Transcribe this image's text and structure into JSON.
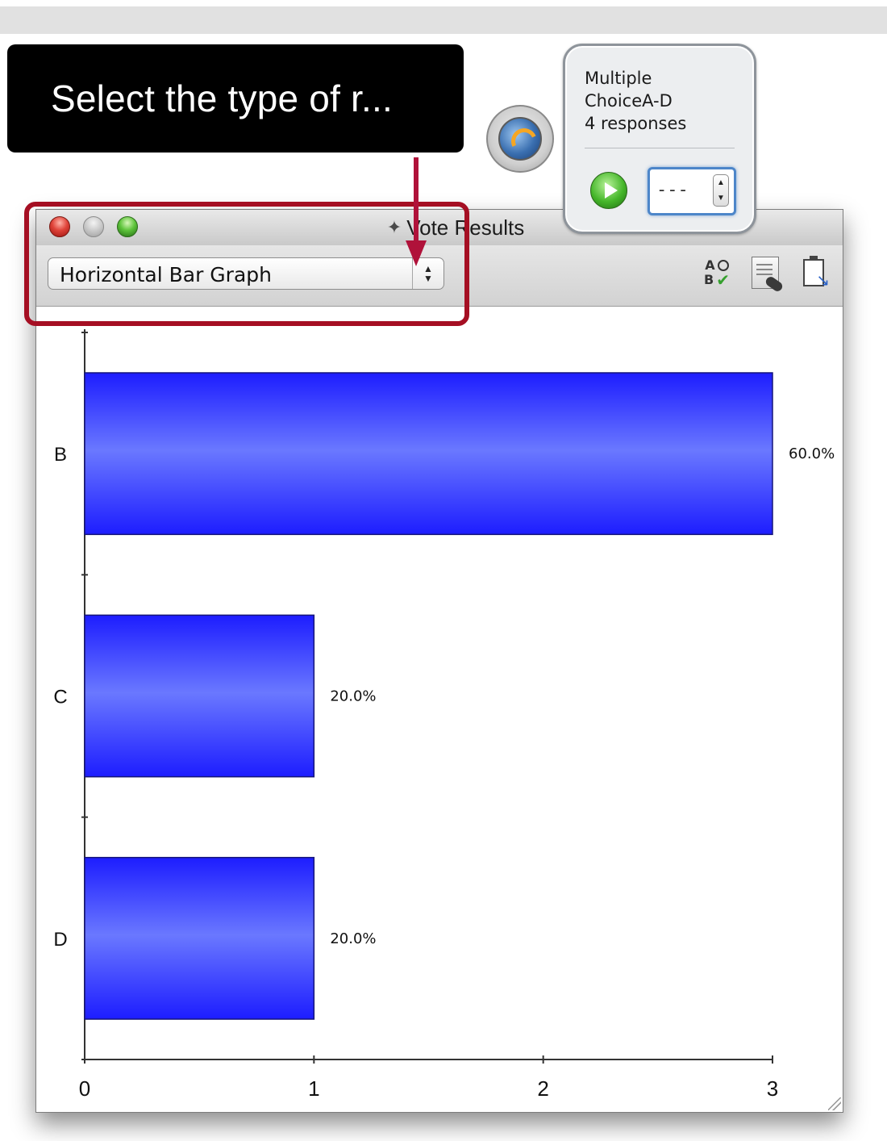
{
  "callout": {
    "text": "Select the type of r..."
  },
  "panel": {
    "line1": "Multiple",
    "line2": "ChoiceA-D",
    "line3": "4 responses",
    "stepper_value": "---"
  },
  "window": {
    "title": "Vote Results",
    "display_type": "Horizontal Bar Graph"
  },
  "icons": {
    "app": "app-icon",
    "answer_key": "answer-key-icon",
    "document": "document-icon",
    "clipboard": "clipboard-export-icon",
    "play": "play-icon"
  },
  "colors": {
    "bar": "#2b2bff",
    "highlight": "#a50f23",
    "arrow": "#b0123a"
  },
  "chart_data": {
    "type": "bar",
    "orientation": "horizontal",
    "categories": [
      "B",
      "C",
      "D"
    ],
    "values": [
      3,
      1,
      1
    ],
    "data_labels": [
      "60.0%",
      "20.0%",
      "20.0%"
    ],
    "xlim": [
      0,
      3
    ],
    "x_ticks": [
      "0",
      "1",
      "2",
      "3"
    ],
    "title": "",
    "xlabel": "",
    "ylabel": ""
  }
}
